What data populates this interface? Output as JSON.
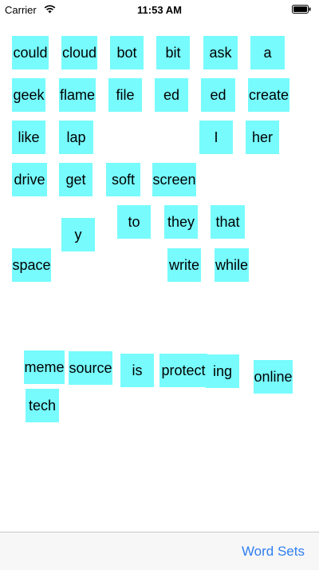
{
  "status_bar": {
    "carrier": "Carrier",
    "time": "11:53 AM",
    "wifi_icon": "wifi-icon",
    "battery_icon": "battery-icon"
  },
  "colors": {
    "tile": "#77fbfd",
    "link": "#2f7ff0",
    "toolbar": "#f7f7f7"
  },
  "tiles": [
    "could",
    "cloud",
    "bot",
    "bit",
    "ask",
    "a",
    "geek",
    "flame",
    "file",
    "ed",
    "ed",
    "create",
    "like",
    "lap",
    "I",
    "her",
    "drive",
    "get",
    "soft",
    "screen",
    "y",
    "to",
    "they",
    "that",
    "space",
    "write",
    "while",
    "meme",
    "source",
    "is",
    "protect",
    "ing",
    "online",
    "tech"
  ],
  "toolbar": {
    "word_sets_label": "Word Sets"
  }
}
